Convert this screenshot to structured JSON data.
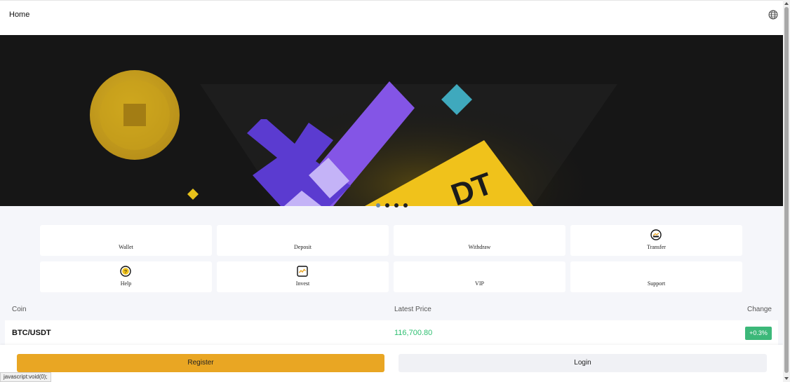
{
  "header": {
    "title": "Home",
    "globe_icon": "globe-icon"
  },
  "banner": {
    "theme_colors": {
      "background": "#151515",
      "coin": "#c9a21a",
      "purple": "#8455e6",
      "yellow": "#f0c21b",
      "teal": "#3aa6b9"
    },
    "ticket_text": "DT",
    "slides": 4,
    "active_slide": 1
  },
  "menu": {
    "items": [
      {
        "label": "Wallet",
        "icon": ""
      },
      {
        "label": "Deposit",
        "icon": ""
      },
      {
        "label": "Withdraw",
        "icon": ""
      },
      {
        "label": "Transfer",
        "icon": "transfer-icon"
      },
      {
        "label": "Help",
        "icon": "help-icon"
      },
      {
        "label": "Invest",
        "icon": "invest-chart-icon"
      },
      {
        "label": "VIP",
        "icon": ""
      },
      {
        "label": "Support",
        "icon": ""
      }
    ]
  },
  "market": {
    "columns": {
      "coin": "Coin",
      "price": "Latest Price",
      "change": "Change"
    },
    "rows": [
      {
        "pair": "BTC/USDT",
        "price": "116,700.80",
        "change": "+0.3%"
      }
    ],
    "colors": {
      "up": "#2fbf71",
      "badge": "#3cb879"
    }
  },
  "footer": {
    "register_label": "Register",
    "login_label": "Login",
    "register_color": "#e9a623"
  },
  "statusbar": {
    "text": "javascript:void(0);"
  }
}
